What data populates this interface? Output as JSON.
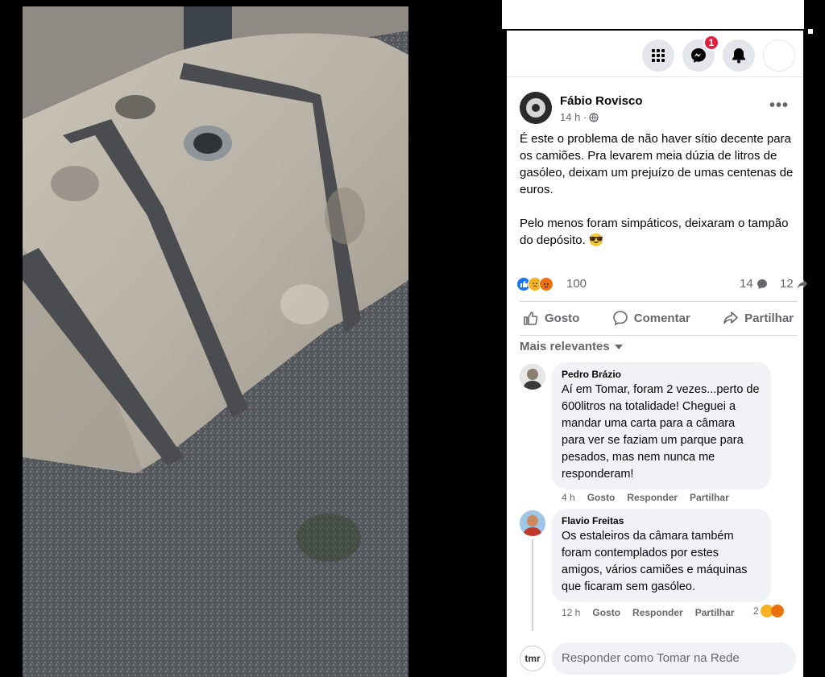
{
  "header": {
    "menu_icon": "grid-menu-icon",
    "messenger_icon": "messenger-icon",
    "messenger_badge": "1",
    "notifications_icon": "bell-icon",
    "colors": {
      "badge": "#e41e3f",
      "button_bg": "#e4e6eb"
    }
  },
  "post": {
    "author": "Fábio Rovisco",
    "time": "14 h ·",
    "audience_icon": "globe-icon",
    "text": "É este o problema de não haver sítio decente para os camiões. Pra levarem meia dúzia de litros de gasóleo, deixam um prejuízo de umas centenas de euros.\n\nPelo menos foram simpáticos, deixaram o tampão do depósito. 😎",
    "reactions_count": "100",
    "comments_count": "14",
    "shares_count": "12"
  },
  "actions": {
    "like": "Gosto",
    "comment": "Comentar",
    "share": "Partilhar"
  },
  "comments_filter": "Mais relevantes",
  "comments": [
    {
      "author": "Pedro Brázio",
      "text": "Aí em Tomar, foram 2 vezes...perto de 600litros na totalidade! Cheguei a mandar uma carta para a câmara para ver se faziam um parque para pesados, mas nem nunca me responderam!",
      "time": "4 h",
      "like": "Gosto",
      "reply": "Responder",
      "share": "Partilhar"
    },
    {
      "author": "Flavio Freitas",
      "text": "Os estaleiros da câmara também foram contemplados por estes amigos, vários camiões e máquinas que ficaram sem gasóleo.",
      "time": "12 h",
      "like": "Gosto",
      "reply": "Responder",
      "share": "Partilhar",
      "reactions": "2"
    }
  ],
  "reply_box": {
    "placeholder": "Responder como Tomar na Rede",
    "page_avatar_text": "tmr"
  }
}
